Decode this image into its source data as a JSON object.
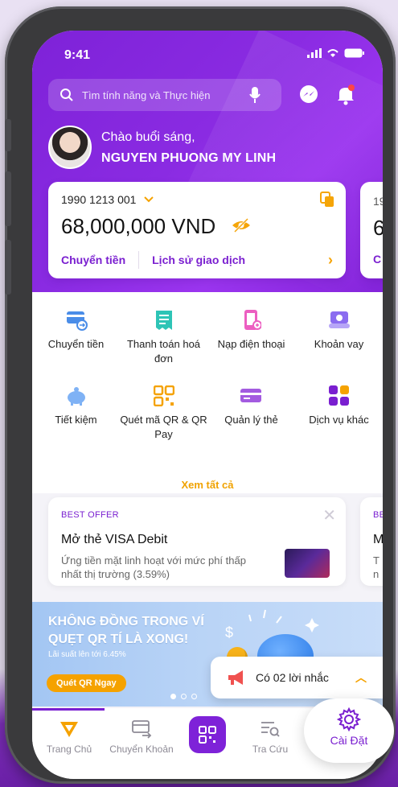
{
  "status_bar": {
    "time": "9:41"
  },
  "search": {
    "placeholder": "Tìm tính năng và Thực hiện"
  },
  "user": {
    "greeting": "Chào buổi sáng,",
    "name": "NGUYEN PHUONG MY LINH"
  },
  "accounts": [
    {
      "number": "1990 1213 001",
      "balance": "68,000,000 VND",
      "actions": [
        "Chuyển tiền",
        "Lịch sử giao dịch"
      ]
    },
    {
      "number_partial": "19",
      "balance_partial": "6",
      "action_partial": "C"
    }
  ],
  "services": [
    {
      "label": "Chuyển tiền",
      "icon": "transfer-card-icon"
    },
    {
      "label": "Thanh toán hoá đơn",
      "icon": "bill-icon"
    },
    {
      "label": "Nạp điện thoại",
      "icon": "phone-topup-icon"
    },
    {
      "label": "Khoản vay",
      "icon": "loan-icon"
    },
    {
      "label": "Tiết kiệm",
      "icon": "piggy-bank-icon"
    },
    {
      "label": "Quét mã QR & QR Pay",
      "icon": "qr-code-icon"
    },
    {
      "label": "Quản lý thẻ",
      "icon": "card-icon"
    },
    {
      "label": "Dịch vụ khác",
      "icon": "more-services-icon"
    }
  ],
  "see_all": "Xem tất cả",
  "offers": [
    {
      "tag": "BEST OFFER",
      "title": "Mở thẻ VISA Debit",
      "desc": "Ứng tiền mặt linh hoạt với mức phí thấp nhất thị trường (3.59%)"
    },
    {
      "tag": "BE",
      "title": "M",
      "desc": "T\nn"
    }
  ],
  "banner": {
    "title": "KHÔNG ĐỒNG TRONG VÍ\nQUẸT QR TÍ LÀ XONG!",
    "subtitle": "Lãi suất lên tới 6.45%",
    "button": "Quét QR Ngay"
  },
  "reminder": {
    "text": "Có 02 lời nhắc"
  },
  "tabs": [
    {
      "label": "Trang Chủ",
      "icon": "home-logo-icon"
    },
    {
      "label": "Chuyển Khoản",
      "icon": "transfer-icon"
    },
    {
      "label": "",
      "icon": "qr-scan-icon"
    },
    {
      "label": "Tra Cứu",
      "icon": "lookup-icon"
    }
  ],
  "settings": {
    "label": "Cài Đặt",
    "icon": "gear-icon"
  },
  "colors": {
    "primary": "#7e22d8",
    "accent": "#f5a200",
    "banner": "#b8d3f6"
  }
}
